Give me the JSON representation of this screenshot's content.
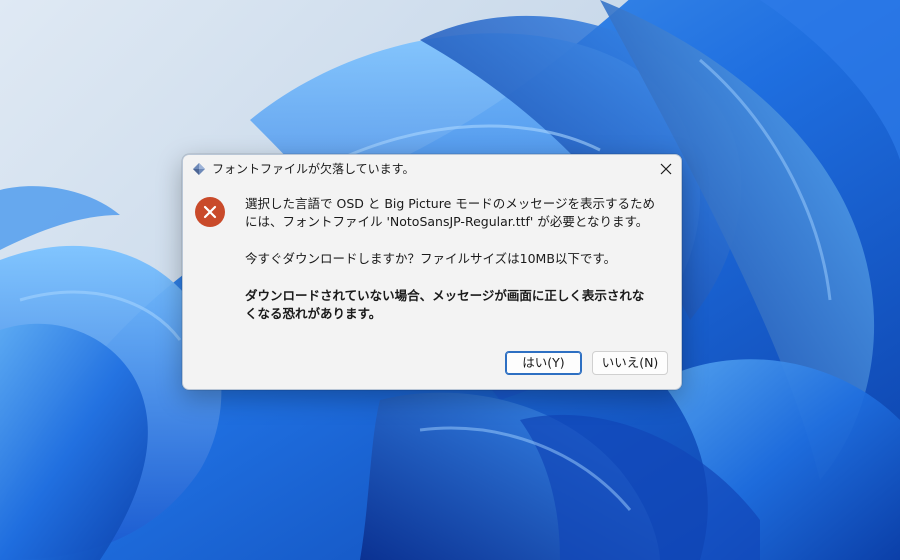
{
  "dialog": {
    "title": "フォントファイルが欠落しています。",
    "icons": {
      "app": "steam-diamond-icon",
      "status": "error-icon",
      "close": "close-icon"
    },
    "message": {
      "line1": "選択した言語で OSD と Big Picture モードのメッセージを表示するため",
      "line2": "には、フォントファイル 'NotoSansJP-Regular.ttf' が必要となります。",
      "line3": "今すぐダウンロードしますか？ファイルサイズは10MB以下です。",
      "line4": "ダウンロードされていない場合、メッセージが画面に正しく表示されな",
      "line5": "くなる恐れがあります。"
    },
    "buttons": {
      "yes": "はい(Y)",
      "no": "いいえ(N)"
    },
    "colors": {
      "error_icon": "#c94a2a",
      "default_button_border": "#2d6fc2"
    }
  }
}
